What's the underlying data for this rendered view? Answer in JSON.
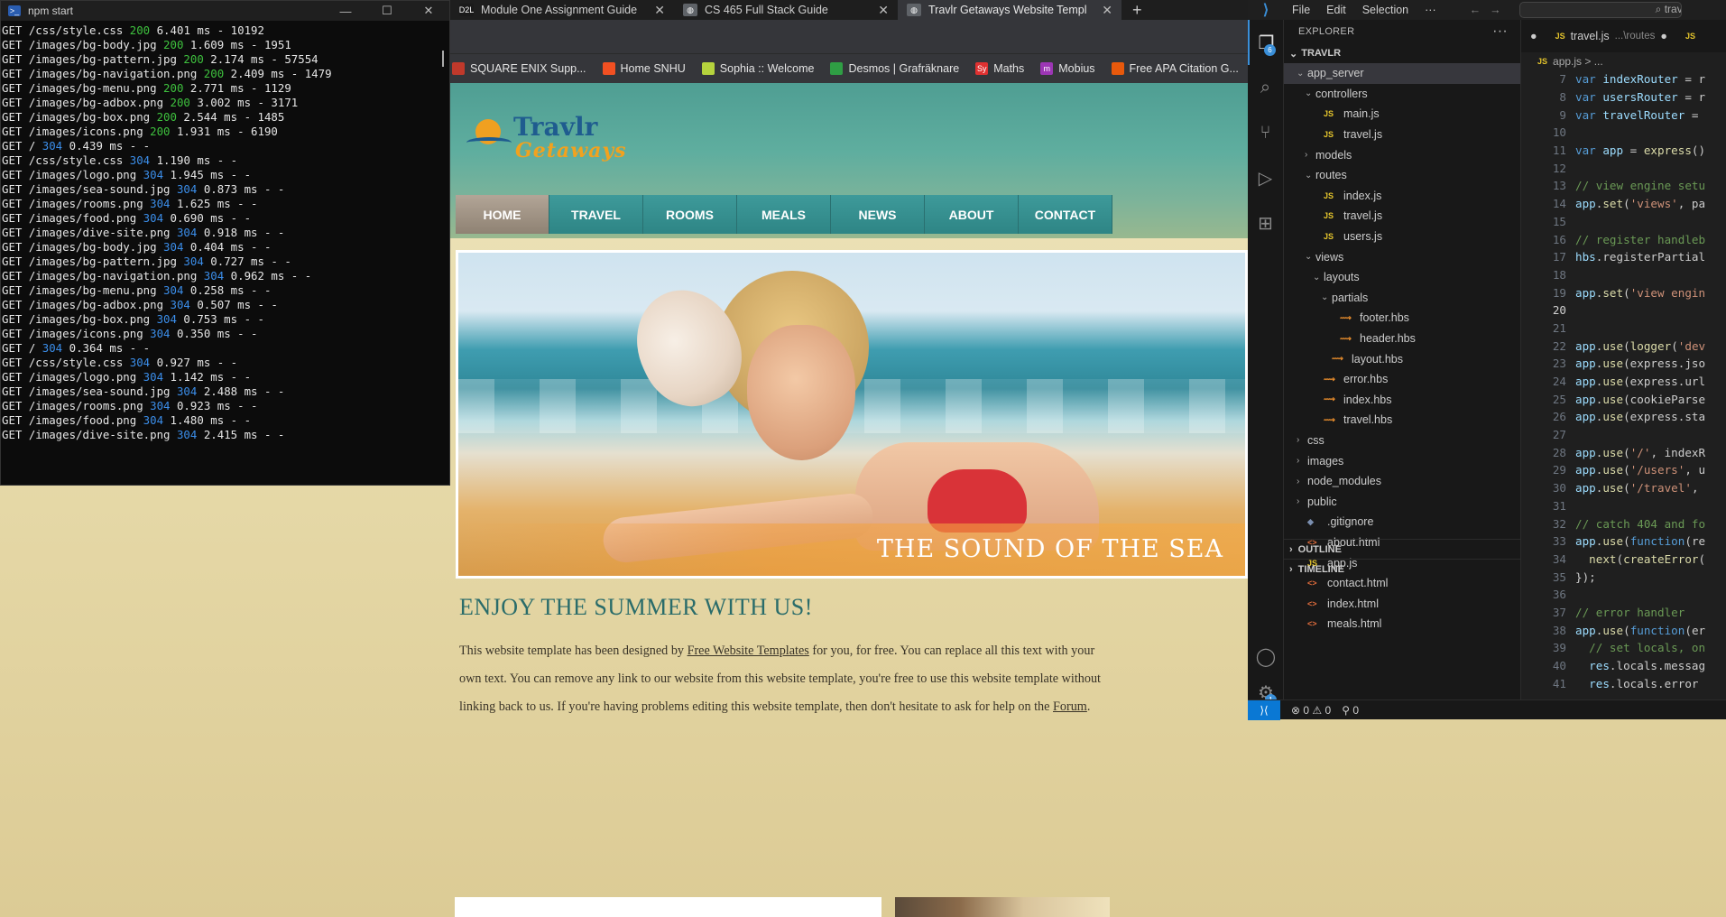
{
  "terminal": {
    "title": "npm start",
    "lines": [
      [
        "GET /css/style.css ",
        "200",
        " 6.401 ms - 10192"
      ],
      [
        "GET /images/bg-body.jpg ",
        "200",
        " 1.609 ms - 1951"
      ],
      [
        "GET /images/bg-pattern.jpg ",
        "200",
        " 2.174 ms - 57554"
      ],
      [
        "GET /images/bg-navigation.png ",
        "200",
        " 2.409 ms - 1479"
      ],
      [
        "GET /images/bg-menu.png ",
        "200",
        " 2.771 ms - 1129"
      ],
      [
        "GET /images/bg-adbox.png ",
        "200",
        " 3.002 ms - 3171"
      ],
      [
        "GET /images/bg-box.png ",
        "200",
        " 2.544 ms - 1485"
      ],
      [
        "GET /images/icons.png ",
        "200",
        " 1.931 ms - 6190"
      ],
      [
        "GET / ",
        "304",
        " 0.439 ms - -"
      ],
      [
        "GET /css/style.css ",
        "304",
        " 1.190 ms - -"
      ],
      [
        "GET /images/logo.png ",
        "304",
        " 1.945 ms - -"
      ],
      [
        "GET /images/sea-sound.jpg ",
        "304",
        " 0.873 ms - -"
      ],
      [
        "GET /images/rooms.png ",
        "304",
        " 1.625 ms - -"
      ],
      [
        "GET /images/food.png ",
        "304",
        " 0.690 ms - -"
      ],
      [
        "GET /images/dive-site.png ",
        "304",
        " 0.918 ms - -"
      ],
      [
        "GET /images/bg-body.jpg ",
        "304",
        " 0.404 ms - -"
      ],
      [
        "GET /images/bg-pattern.jpg ",
        "304",
        " 0.727 ms - -"
      ],
      [
        "GET /images/bg-navigation.png ",
        "304",
        " 0.962 ms - -"
      ],
      [
        "GET /images/bg-menu.png ",
        "304",
        " 0.258 ms - -"
      ],
      [
        "GET /images/bg-adbox.png ",
        "304",
        " 0.507 ms - -"
      ],
      [
        "GET /images/bg-box.png ",
        "304",
        " 0.753 ms - -"
      ],
      [
        "GET /images/icons.png ",
        "304",
        " 0.350 ms - -"
      ],
      [
        "GET / ",
        "304",
        " 0.364 ms - -"
      ],
      [
        "GET /css/style.css ",
        "304",
        " 0.927 ms - -"
      ],
      [
        "GET /images/logo.png ",
        "304",
        " 1.142 ms - -"
      ],
      [
        "GET /images/sea-sound.jpg ",
        "304",
        " 2.488 ms - -"
      ],
      [
        "GET /images/rooms.png ",
        "304",
        " 0.923 ms - -"
      ],
      [
        "GET /images/food.png ",
        "304",
        " 1.480 ms - -"
      ],
      [
        "GET /images/dive-site.png ",
        "304",
        " 2.415 ms - -"
      ]
    ]
  },
  "browser": {
    "tabs": [
      {
        "label": "Module One Assignment Guide",
        "icon": "D2L",
        "icon_color": "#1a1a1a",
        "active": false
      },
      {
        "label": "CS 465 Full Stack Guide",
        "icon": "globe",
        "icon_color": "#5f6368",
        "active": false
      },
      {
        "label": "Travlr Getaways Website Templ",
        "icon": "globe",
        "icon_color": "#5f6368",
        "active": true
      }
    ],
    "new_tab": "+",
    "bookmarks": [
      {
        "label": "SQUARE ENIX Supp...",
        "color": "#c0392b"
      },
      {
        "label": "Home SNHU",
        "color": "#f25022"
      },
      {
        "label": "Sophia :: Welcome",
        "color": "#b5d33d"
      },
      {
        "label": "Desmos | Grafräknare",
        "color": "#2f9e44"
      },
      {
        "label": "Maths",
        "icon_text": "Sy",
        "color": "#e03131"
      },
      {
        "label": "Mobius",
        "icon_text": "m",
        "color": "#9c36b5"
      },
      {
        "label": "Free APA Citation G...",
        "color": "#e8590c"
      }
    ]
  },
  "site": {
    "logo_line1": "Travlr",
    "logo_line2": "Getaways",
    "nav": [
      "HOME",
      "TRAVEL",
      "ROOMS",
      "MEALS",
      "NEWS",
      "ABOUT",
      "CONTACT"
    ],
    "hero_caption": "THE SOUND OF THE SEA",
    "heading": "ENJOY THE SUMMER WITH US!",
    "para_1": "This website template has been designed by ",
    "link_1": "Free Website Templates",
    "para_2": " for you, for free. You can replace all this text with your own text. You can remove any link to our website from this website template, you're free to use this website template without linking back to us. If you're having problems editing this website template, then don't hesitate to ask for help on the ",
    "link_2": "Forum",
    "para_3": "."
  },
  "vscode": {
    "menu": [
      "File",
      "Edit",
      "Selection",
      "···"
    ],
    "search_text": "travl",
    "explorer_title": "EXPLORER",
    "project": "TRAVLR",
    "tree": [
      {
        "label": "app_server",
        "depth": 0,
        "type": "folder-open",
        "selected": true
      },
      {
        "label": "controllers",
        "depth": 1,
        "type": "folder-open"
      },
      {
        "label": "main.js",
        "depth": 2,
        "type": "js"
      },
      {
        "label": "travel.js",
        "depth": 2,
        "type": "js"
      },
      {
        "label": "models",
        "depth": 1,
        "type": "folder"
      },
      {
        "label": "routes",
        "depth": 1,
        "type": "folder-open"
      },
      {
        "label": "index.js",
        "depth": 2,
        "type": "js"
      },
      {
        "label": "travel.js",
        "depth": 2,
        "type": "js"
      },
      {
        "label": "users.js",
        "depth": 2,
        "type": "js"
      },
      {
        "label": "views",
        "depth": 1,
        "type": "folder-open"
      },
      {
        "label": "layouts",
        "depth": 2,
        "type": "folder-open"
      },
      {
        "label": "partials",
        "depth": 3,
        "type": "folder-open"
      },
      {
        "label": "footer.hbs",
        "depth": 4,
        "type": "hbs"
      },
      {
        "label": "header.hbs",
        "depth": 4,
        "type": "hbs"
      },
      {
        "label": "layout.hbs",
        "depth": 3,
        "type": "hbs"
      },
      {
        "label": "error.hbs",
        "depth": 2,
        "type": "hbs"
      },
      {
        "label": "index.hbs",
        "depth": 2,
        "type": "hbs"
      },
      {
        "label": "travel.hbs",
        "depth": 2,
        "type": "hbs"
      },
      {
        "label": "css",
        "depth": 0,
        "type": "folder"
      },
      {
        "label": "images",
        "depth": 0,
        "type": "folder"
      },
      {
        "label": "node_modules",
        "depth": 0,
        "type": "folder"
      },
      {
        "label": "public",
        "depth": 0,
        "type": "folder"
      },
      {
        "label": ".gitignore",
        "depth": 0,
        "type": "git"
      },
      {
        "label": "about.html",
        "depth": 0,
        "type": "html"
      },
      {
        "label": "app.js",
        "depth": 0,
        "type": "js"
      },
      {
        "label": "contact.html",
        "depth": 0,
        "type": "html"
      },
      {
        "label": "index.html",
        "depth": 0,
        "type": "html"
      },
      {
        "label": "meals.html",
        "depth": 0,
        "type": "html"
      }
    ],
    "outline": "OUTLINE",
    "timeline": "TIMELINE",
    "editor_tab_1": "travel.js",
    "editor_tab_1_path": "...\\routes",
    "breadcrumb": "app.js >  ...",
    "code": [
      {
        "n": "7",
        "t": "var indexRouter = r"
      },
      {
        "n": "8",
        "t": "var usersRouter = r"
      },
      {
        "n": "9",
        "t": "var travelRouter ="
      },
      {
        "n": "10",
        "t": ""
      },
      {
        "n": "11",
        "t": "var app = express()"
      },
      {
        "n": "12",
        "t": ""
      },
      {
        "n": "13",
        "t": "// view engine setu"
      },
      {
        "n": "14",
        "t": "app.set('views', pa"
      },
      {
        "n": "15",
        "t": ""
      },
      {
        "n": "16",
        "t": "// register handleb"
      },
      {
        "n": "17",
        "t": "hbs.registerPartial"
      },
      {
        "n": "18",
        "t": ""
      },
      {
        "n": "19",
        "t": "app.set('view engin"
      },
      {
        "n": "20",
        "t": "",
        "current": true
      },
      {
        "n": "21",
        "t": ""
      },
      {
        "n": "22",
        "t": "app.use(logger('dev"
      },
      {
        "n": "23",
        "t": "app.use(express.jso"
      },
      {
        "n": "24",
        "t": "app.use(express.url"
      },
      {
        "n": "25",
        "t": "app.use(cookieParse"
      },
      {
        "n": "26",
        "t": "app.use(express.sta"
      },
      {
        "n": "27",
        "t": ""
      },
      {
        "n": "28",
        "t": "app.use('/', indexR"
      },
      {
        "n": "29",
        "t": "app.use('/users', u"
      },
      {
        "n": "30",
        "t": "app.use('/travel', "
      },
      {
        "n": "31",
        "t": ""
      },
      {
        "n": "32",
        "t": "// catch 404 and fo"
      },
      {
        "n": "33",
        "t": "app.use(function(re"
      },
      {
        "n": "34",
        "t": "  next(createError("
      },
      {
        "n": "35",
        "t": "});"
      },
      {
        "n": "36",
        "t": ""
      },
      {
        "n": "37",
        "t": "// error handler"
      },
      {
        "n": "38",
        "t": "app.use(function(er"
      },
      {
        "n": "39",
        "t": "  // set locals, on"
      },
      {
        "n": "40",
        "t": "  res.locals.messag"
      },
      {
        "n": "41",
        "t": "  res.locals.error "
      }
    ],
    "status_errors": "0",
    "status_warnings": "0",
    "status_ports": "0",
    "badge_explorer": "6",
    "badge_settings": "1"
  }
}
